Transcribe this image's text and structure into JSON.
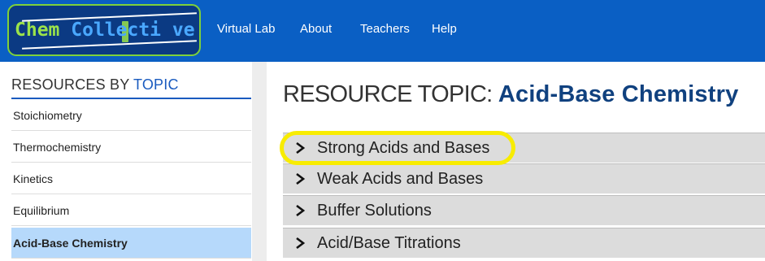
{
  "header": {
    "logo": {
      "text_part1": "Chem",
      "text_part2": "Coll",
      "text_part3": "ecti ve"
    },
    "nav": [
      "Virtual Lab",
      "About",
      "Teachers",
      "Help"
    ]
  },
  "sidebar": {
    "title_prefix": "RESOURCES BY ",
    "title_topic": "TOPIC",
    "items": [
      {
        "label": "Stoichiometry"
      },
      {
        "label": "Thermochemistry"
      },
      {
        "label": "Kinetics"
      },
      {
        "label": "Equilibrium"
      },
      {
        "label": "Acid-Base Chemistry",
        "active": true
      }
    ]
  },
  "main": {
    "title_prefix": "RESOURCE TOPIC: ",
    "title_topic": "Acid-Base Chemistry",
    "sections": [
      {
        "label": "Strong Acids and Bases",
        "highlighted": true
      },
      {
        "label": "Weak Acids and Bases"
      },
      {
        "label": "Buffer Solutions"
      },
      {
        "label": "Acid/Base Titrations"
      }
    ]
  },
  "colors": {
    "header_bg": "#0a5fc4",
    "active_item": "#b6d9fb",
    "highlight": "#f8ec00",
    "title_blue": "#10417f"
  }
}
